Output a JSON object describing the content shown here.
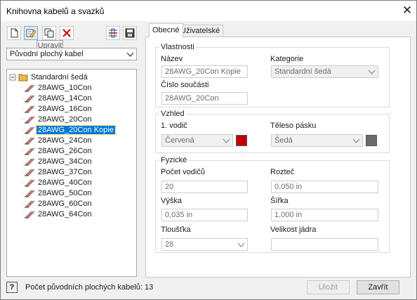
{
  "window": {
    "title": "Knihovna kabelů a svazků"
  },
  "toolbar": {
    "tooltip": "Upravit",
    "buttons": [
      "new-icon",
      "edit-icon",
      "copy-icon",
      "delete-icon",
      "compare-icon",
      "save-library-icon"
    ]
  },
  "library_select": {
    "value": "Původní plochý kabel"
  },
  "tree": {
    "root": "Standardní šedá",
    "items": [
      {
        "label": "28AWG_10Con",
        "selected": false
      },
      {
        "label": "28AWG_14Con",
        "selected": false
      },
      {
        "label": "28AWG_16Con",
        "selected": false
      },
      {
        "label": "28AWG_20Con",
        "selected": false
      },
      {
        "label": "28AWG_20Con Kopie",
        "selected": true
      },
      {
        "label": "28AWG_24Con",
        "selected": false
      },
      {
        "label": "28AWG_26Con",
        "selected": false
      },
      {
        "label": "28AWG_34Con",
        "selected": false
      },
      {
        "label": "28AWG_37Con",
        "selected": false
      },
      {
        "label": "28AWG_40Con",
        "selected": false
      },
      {
        "label": "28AWG_50Con",
        "selected": false
      },
      {
        "label": "28AWG_60Con",
        "selected": false
      },
      {
        "label": "28AWG_64Con",
        "selected": false
      }
    ]
  },
  "tabs": [
    {
      "label": "Obecné",
      "active": true
    },
    {
      "label": "Uživatelské",
      "active": false
    }
  ],
  "properties": {
    "group_title": "Vlastnosti",
    "name_label": "Název",
    "name_value": "28AWG_20Con Kopie",
    "category_label": "Kategorie",
    "category_value": "Standardní šedá",
    "part_number_label": "Číslo součásti",
    "part_number_value": "28AWG_20Con"
  },
  "appearance": {
    "group_title": "Vzhled",
    "first_wire_label": "1. vodič",
    "first_wire_value": "Červená",
    "first_wire_color": "#c40000",
    "tape_body_label": "Těleso pásku",
    "tape_body_value": "Šedá",
    "tape_body_color": "#6b6b6b"
  },
  "physical": {
    "group_title": "Fyzické",
    "wire_count_label": "Počet vodičů",
    "wire_count_value": "20",
    "pitch_label": "Rozteč",
    "pitch_value": "0,050 in",
    "height_label": "Výška",
    "height_value": "0,035 in",
    "width_label": "Šířka",
    "width_value": "1,000 in",
    "thickness_label": "Tloušťka",
    "thickness_value": "28",
    "core_size_label": "Velikost jádra",
    "core_size_value": ""
  },
  "status": {
    "text": "Počet původních plochých kabelů: 13"
  },
  "footer": {
    "save_label": "Uložit",
    "save_disabled": true,
    "close_label": "Zavřít"
  },
  "colors": {
    "selection": "#0078d7",
    "folder": "#e8b84a"
  }
}
